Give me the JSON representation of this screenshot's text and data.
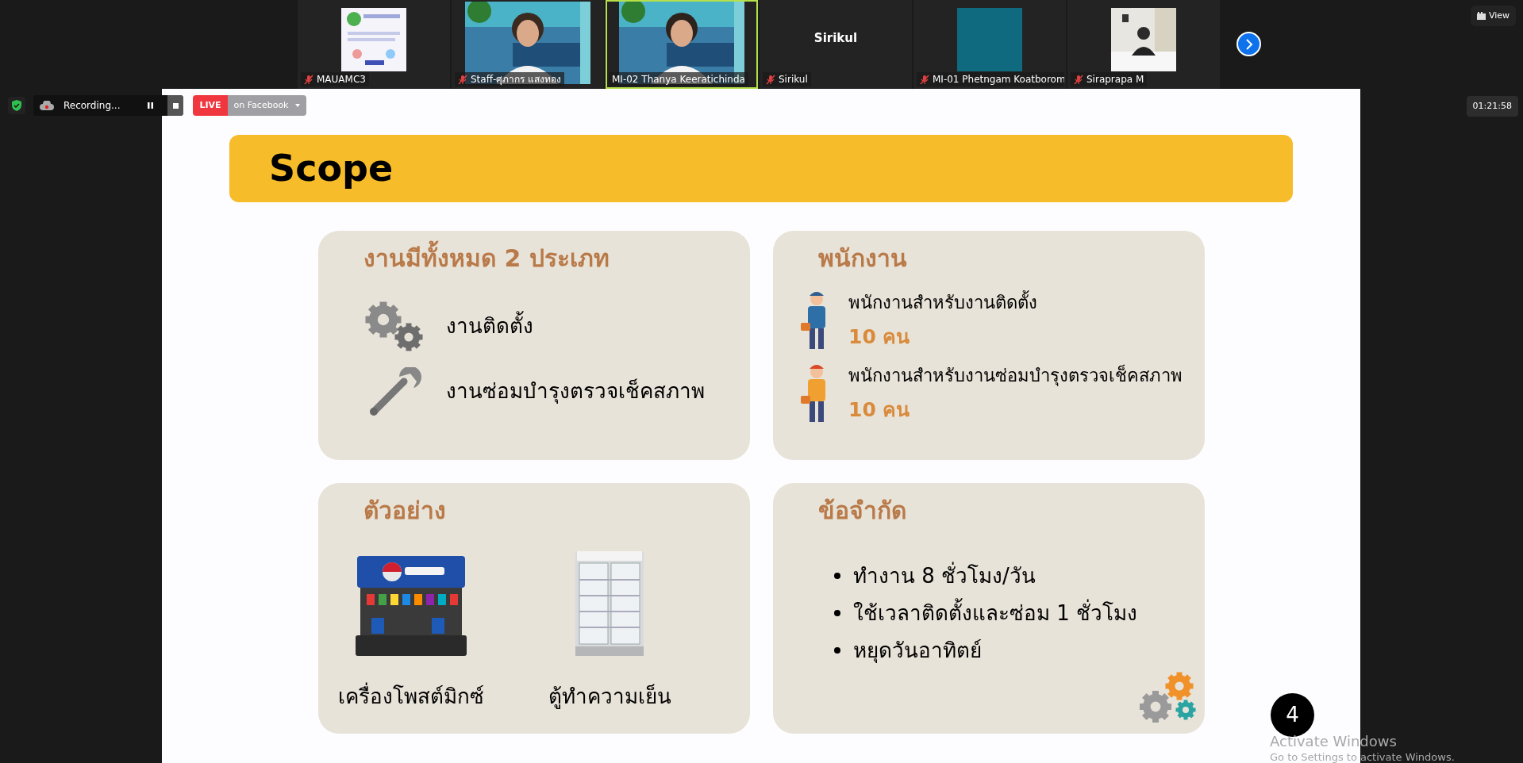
{
  "participants": [
    {
      "name": "MAUAMC3",
      "kind": "picture",
      "muted": true,
      "speaking": false
    },
    {
      "name": "Staff-ศุภากร แสงทอง",
      "kind": "video",
      "muted": true,
      "speaking": false
    },
    {
      "name": "MI-02 Thanya Keeratichinda",
      "kind": "video",
      "muted": false,
      "speaking": true
    },
    {
      "name": "Sirikul",
      "kind": "name",
      "display_name": "Sirikul",
      "muted": true,
      "speaking": false
    },
    {
      "name": "MI-01 Phetngam Koatborom",
      "kind": "avatar",
      "muted": true,
      "speaking": false
    },
    {
      "name": "Siraprapa M",
      "kind": "video",
      "muted": true,
      "speaking": false
    }
  ],
  "view_button": "View",
  "recording": {
    "label": "Recording..."
  },
  "live": {
    "badge": "LIVE",
    "label": "on Facebook"
  },
  "timer": "01:21:58",
  "slide": {
    "title": "Scope",
    "cards": [
      {
        "kind": "tasks",
        "title": "งานมีทั้งหมด 2 ประเภท",
        "items": [
          {
            "text": "งานติดตั้ง"
          },
          {
            "text": "งานซ่อมบำรุงตรวจเช็คสภาพ"
          }
        ]
      },
      {
        "kind": "staff",
        "title": "พนักงาน",
        "items": [
          {
            "text": "พนักงานสำหรับงานติดตั้ง",
            "count": "10 คน"
          },
          {
            "text": "พนักงานสำหรับงานซ่อมบำรุงตรวจเช็คสภาพ",
            "count": "10 คน"
          }
        ]
      },
      {
        "kind": "examples",
        "title": "ตัวอย่าง",
        "items": [
          {
            "text": "เครื่องโพสต์มิกซ์"
          },
          {
            "text": "ตู้ทำความเย็น"
          }
        ]
      },
      {
        "kind": "limits",
        "title": "ข้อจำกัด",
        "bullets": [
          "ทำงาน 8 ชั่วโมง/วัน",
          "ใช้เวลาติดตั้งและซ่อม 1 ชั่วโมง",
          "หยุดวันอาทิตย์"
        ]
      }
    ],
    "page_number": "4"
  },
  "watermark": {
    "title": "Activate Windows",
    "subtitle": "Go to Settings to activate Windows."
  }
}
